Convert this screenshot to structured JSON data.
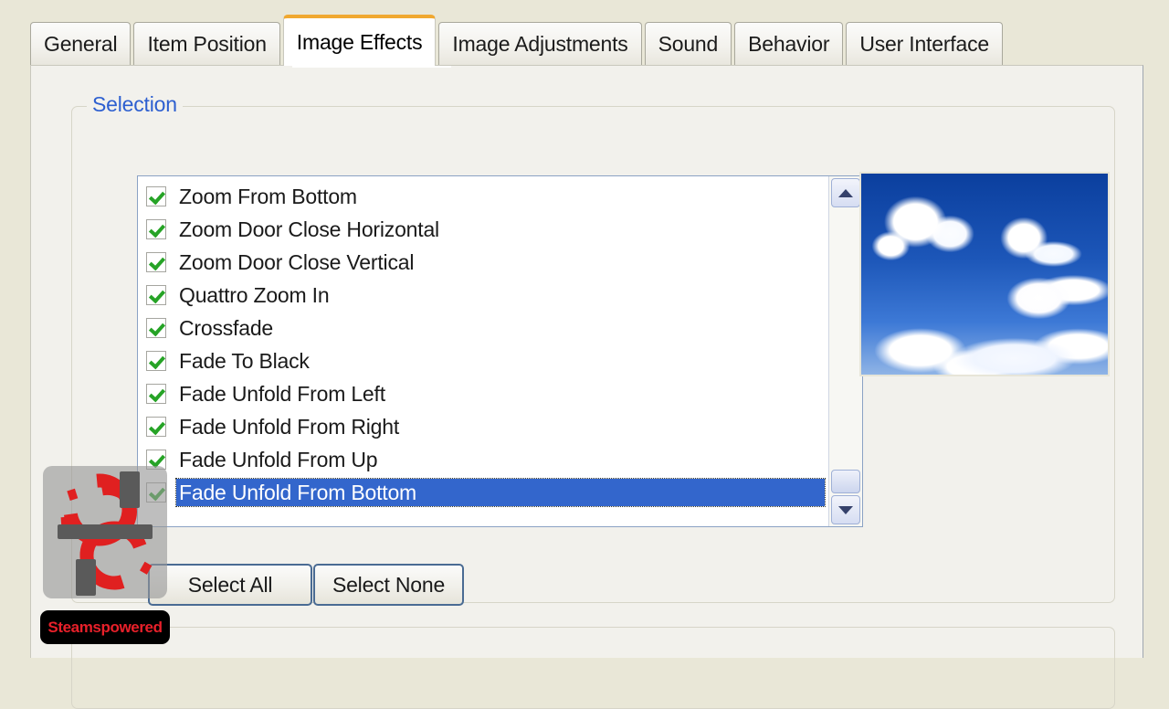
{
  "window": {
    "background_color": "#e9e7d7",
    "panel_color": "#f2f1ec"
  },
  "tabs": [
    {
      "label": "General",
      "active": false
    },
    {
      "label": "Item Position",
      "active": false
    },
    {
      "label": "Image Effects",
      "active": true
    },
    {
      "label": "Image Adjustments",
      "active": false
    },
    {
      "label": "Sound",
      "active": false
    },
    {
      "label": "Behavior",
      "active": false
    },
    {
      "label": "User Interface",
      "active": false
    }
  ],
  "active_tab_accent_color": "#f0a830",
  "groups": {
    "selection": {
      "title": "Selection"
    },
    "second": {
      "title": ""
    }
  },
  "listbox": {
    "selection_color": "#3366cc",
    "checkmark_color": "#26a326",
    "items": [
      {
        "label": "Zoom From Bottom",
        "checked": true,
        "selected": false
      },
      {
        "label": "Zoom Door Close Horizontal",
        "checked": true,
        "selected": false
      },
      {
        "label": "Zoom Door Close Vertical",
        "checked": true,
        "selected": false
      },
      {
        "label": "Quattro Zoom In",
        "checked": true,
        "selected": false
      },
      {
        "label": "Crossfade",
        "checked": true,
        "selected": false
      },
      {
        "label": "Fade To Black",
        "checked": true,
        "selected": false
      },
      {
        "label": "Fade Unfold From Left",
        "checked": true,
        "selected": false
      },
      {
        "label": "Fade Unfold From Right",
        "checked": true,
        "selected": false
      },
      {
        "label": "Fade Unfold From Up",
        "checked": true,
        "selected": false
      },
      {
        "label": "Fade Unfold From Bottom",
        "checked": true,
        "selected": true
      }
    ],
    "scrollbar": {
      "up_icon": "chevron-up-icon",
      "down_icon": "chevron-down-icon",
      "thumb_position": "bottom"
    }
  },
  "preview": {
    "alt": "blue sky with white cumulus clouds"
  },
  "buttons": {
    "select_all": "Select All",
    "select_none": "Select None"
  },
  "watermark": {
    "icon": "steam-gear-icon",
    "label": "Steamspowered",
    "label_color": "#e8202a",
    "label_background": "#000000"
  }
}
